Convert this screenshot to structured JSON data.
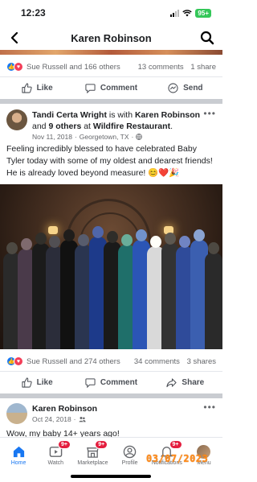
{
  "status_bar": {
    "time": "12:23",
    "battery": "95+"
  },
  "header": {
    "title": "Karen Robinson",
    "back_icon": "chevron-left-icon",
    "search_icon": "search-icon"
  },
  "top_post_stats": {
    "reactions": "Sue Russell and 166 others",
    "comments": "13 comments",
    "shares": "1 share"
  },
  "top_post_actions": {
    "like": "Like",
    "comment": "Comment",
    "send": "Send"
  },
  "post": {
    "author": "Tandi Certa Wright",
    "with_text": " is with ",
    "tagged": "Karen Robinson",
    "and_text": " and ",
    "others": "9 others",
    "at_text": " at ",
    "place": "Wildfire Restaurant",
    "period": ".",
    "date": "Nov 11, 2018",
    "location": "Georgetown, TX",
    "text": "Feeling incredibly blessed to have celebrated Baby Tyler today with some of my oldest and dearest friends! He is already loved beyond measure! 😊❤️🎉",
    "stats": {
      "reactions": "Sue Russell and 274 others",
      "comments": "34 comments",
      "shares": "3 shares"
    },
    "actions": {
      "like": "Like",
      "comment": "Comment",
      "share": "Share"
    }
  },
  "post2": {
    "author": "Karen Robinson",
    "date": "Oct 24, 2018",
    "text": "Wow, my baby 14+ years ago!"
  },
  "bottom_nav": {
    "home": "Home",
    "watch": "Watch",
    "watch_badge": "9+",
    "marketplace": "Marketplace",
    "marketplace_badge": "9+",
    "profile": "Profile",
    "notifications": "Notifications",
    "notifications_badge": "9+",
    "menu": "Menu"
  },
  "date_stamp": "03/07/2023",
  "colors": {
    "accent": "#1877f2",
    "badge": "#e41e3f",
    "stamp": "#ff8c1a"
  }
}
